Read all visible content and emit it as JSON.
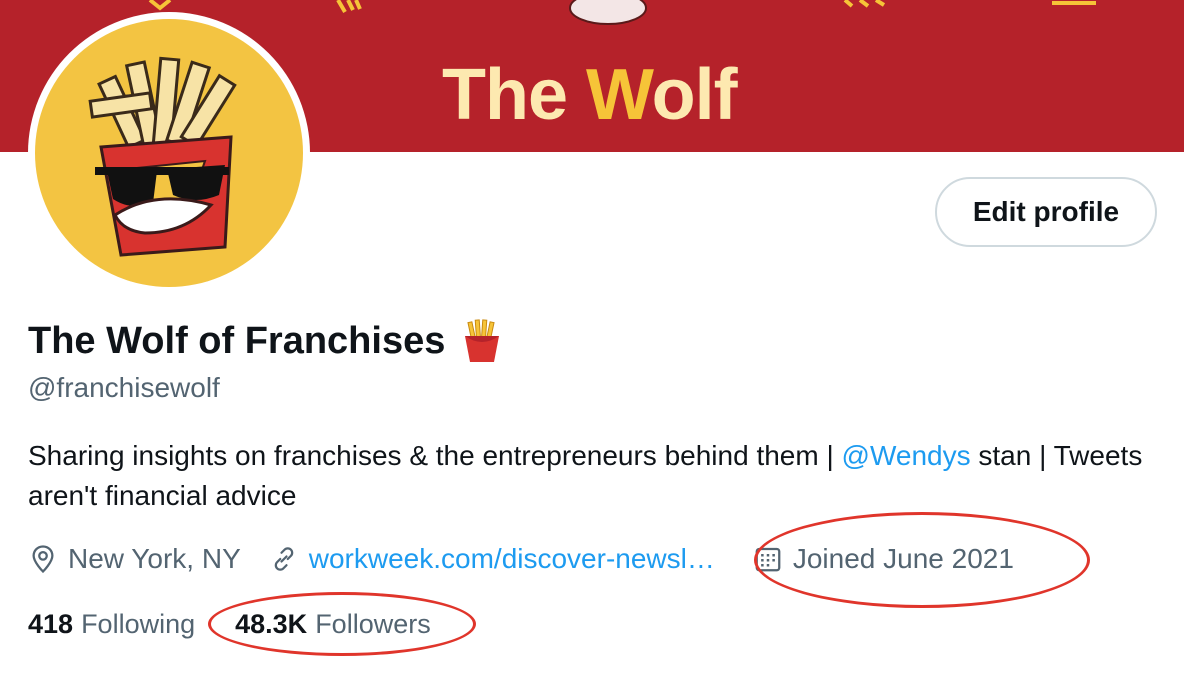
{
  "banner": {
    "title_part1": "The ",
    "title_accent": "W",
    "title_part2": "olf",
    "background_color": "#b5222a"
  },
  "avatar": {
    "icon": "fries-box-with-sunglasses",
    "background_color": "#f3c442"
  },
  "actions": {
    "edit_profile_label": "Edit profile"
  },
  "profile": {
    "display_name": "The Wolf of Franchises",
    "name_emoji": "french-fries-icon",
    "handle": "@franchisewolf",
    "bio_part1": "Sharing insights on franchises & the entrepreneurs behind them | ",
    "bio_mention": "@Wendys",
    "bio_part2": " stan | Tweets aren't financial advice",
    "location": "New York, NY",
    "website": "workweek.com/discover-newsl…",
    "joined": "Joined June 2021"
  },
  "stats": {
    "following_count": "418",
    "following_label": "Following",
    "followers_count": "48.3K",
    "followers_label": "Followers"
  },
  "colors": {
    "link": "#1d9bf0",
    "secondary_text": "#536471",
    "annotation": "#e0352b"
  }
}
